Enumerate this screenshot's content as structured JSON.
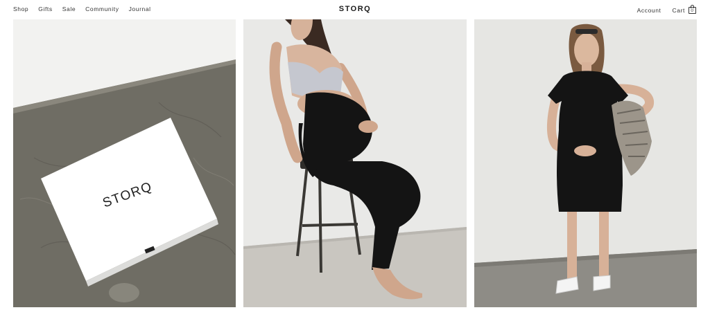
{
  "nav": {
    "left_links": [
      "Shop",
      "Gifts",
      "Sale",
      "Community",
      "Journal"
    ],
    "logo": "STORQ",
    "account": "Account",
    "cart_label": "Cart",
    "cart_count": "0"
  },
  "tiles": [
    {
      "name": "gift-box-photo",
      "box_brand": "STORQ"
    },
    {
      "name": "maternity-leggings-photo"
    },
    {
      "name": "maternity-dress-photo"
    }
  ],
  "colors": {
    "text": "#333333",
    "background": "#ffffff",
    "concrete": "#6f6d64",
    "wall": "#e9e9e7",
    "garment": "#141414"
  }
}
